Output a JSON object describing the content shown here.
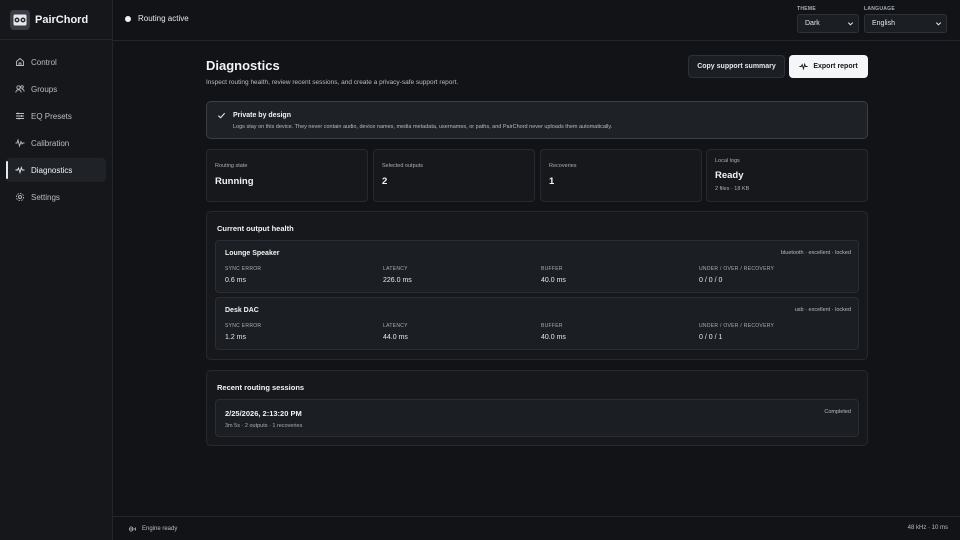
{
  "app": {
    "name": "PairChord"
  },
  "sidebar": {
    "items": [
      {
        "label": "Control",
        "icon": "home-icon"
      },
      {
        "label": "Groups",
        "icon": "users-icon"
      },
      {
        "label": "EQ Presets",
        "icon": "sliders-icon"
      },
      {
        "label": "Calibration",
        "icon": "waveform-icon"
      },
      {
        "label": "Diagnostics",
        "icon": "pulse-icon",
        "active": true
      },
      {
        "label": "Settings",
        "icon": "gear-icon"
      }
    ]
  },
  "topbar": {
    "status": "Routing active",
    "theme": {
      "label": "THEME",
      "value": "Dark"
    },
    "language": {
      "label": "LANGUAGE",
      "value": "English"
    }
  },
  "page": {
    "title": "Diagnostics",
    "description": "Inspect routing health, review recent sessions, and create a privacy-safe support report.",
    "copy_button": "Copy support summary",
    "export_button": "Export report"
  },
  "privacy": {
    "title": "Private by design",
    "text": "Logs stay on this device. They never contain audio, device names, media metadata, usernames, or paths, and PairChord never uploads them automatically."
  },
  "stats": {
    "routing_state": {
      "label": "Routing state",
      "value": "Running"
    },
    "selected_outputs": {
      "label": "Selected outputs",
      "value": "2"
    },
    "recoveries": {
      "label": "Recoveries",
      "value": "1"
    },
    "local_logs": {
      "label": "Local logs",
      "value": "Ready",
      "sub": "2 files · 18 KB"
    }
  },
  "health": {
    "title": "Current output health",
    "labels": {
      "sync": "SYNC ERROR",
      "latency": "LATENCY",
      "buffer": "BUFFER",
      "uor": "UNDER / OVER / RECOVERY"
    },
    "outputs": [
      {
        "name": "Lounge Speaker",
        "meta": "bluetooth · excellent · locked",
        "sync": "0.6 ms",
        "latency": "226.0 ms",
        "buffer": "40.0 ms",
        "uor": "0 / 0 / 0"
      },
      {
        "name": "Desk DAC",
        "meta": "usb · excellent · locked",
        "sync": "1.2 ms",
        "latency": "44.0 ms",
        "buffer": "40.0 ms",
        "uor": "0 / 0 / 1"
      }
    ]
  },
  "sessions": {
    "title": "Recent routing sessions",
    "items": [
      {
        "date": "2/25/2026, 2:13:20 PM",
        "status": "Completed",
        "meta": "3m 5s · 2 outputs · 1 recoveries"
      }
    ]
  },
  "footer": {
    "engine": "Engine ready",
    "rate": "48 kHz · 10 ms"
  }
}
